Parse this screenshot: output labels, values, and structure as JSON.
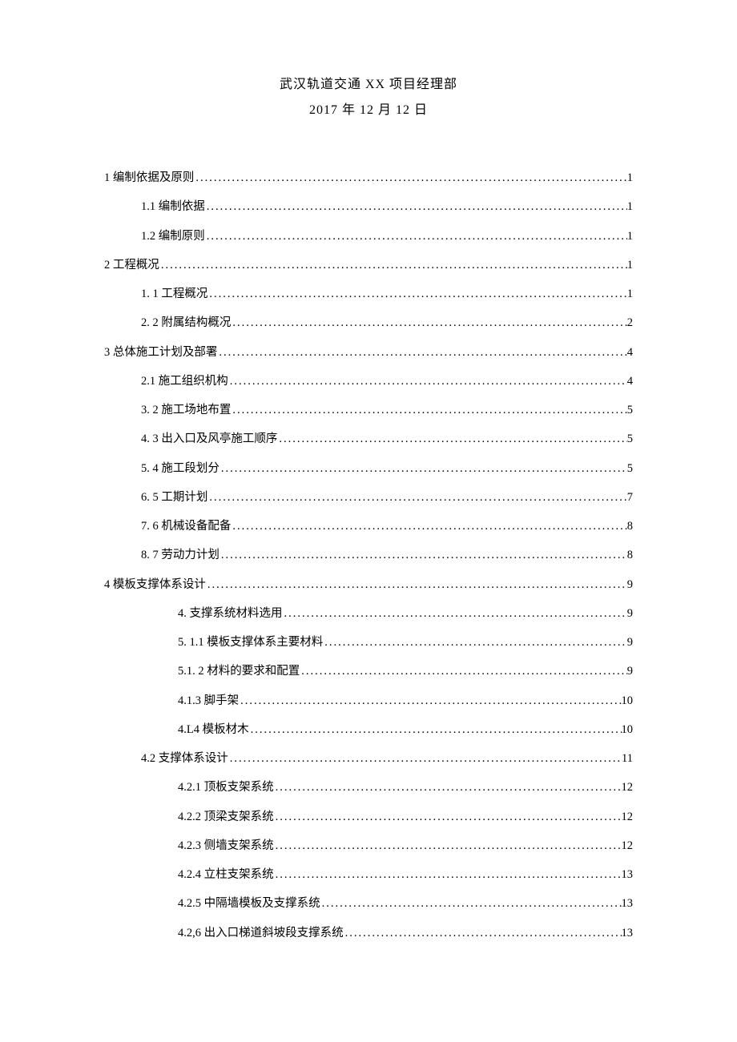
{
  "header": {
    "line1": "武汉轨道交通 XX 项目经理部",
    "line2": "2017 年 12 月 12 日"
  },
  "toc": [
    {
      "indent": 0,
      "label": "1 编制依据及原则",
      "page": "1"
    },
    {
      "indent": 1,
      "label": "1.1  编制依据",
      "page": "1"
    },
    {
      "indent": 1,
      "label": "1.2  编制原则",
      "page": "1"
    },
    {
      "indent": 0,
      "label": "2 工程概况",
      "page": "1"
    },
    {
      "indent": 1,
      "label": "1.  1 工程概况",
      "page": "1"
    },
    {
      "indent": 1,
      "label": "2.  2 附属结构概况",
      "page": "2"
    },
    {
      "indent": 0,
      "label": "3 总体施工计划及部署",
      "page": "4"
    },
    {
      "indent": 1,
      "label": "2.1  施工组织机构",
      "page": "4"
    },
    {
      "indent": 1,
      "label": "3.  2 施工场地布置",
      "page": "5"
    },
    {
      "indent": 1,
      "label": "4.  3 出入口及风亭施工顺序",
      "page": "5"
    },
    {
      "indent": 1,
      "label": "5.  4 施工段划分",
      "page": "5"
    },
    {
      "indent": 1,
      "label": "6.  5 工期计划",
      "page": "7"
    },
    {
      "indent": 1,
      "label": "7.  6 机械设备配备",
      "page": "8"
    },
    {
      "indent": 1,
      "label": "8.  7 劳动力计划",
      "page": "8"
    },
    {
      "indent": 0,
      "label": "4 模板支撑体系设计",
      "page": "9"
    },
    {
      "indent": 2,
      "label": "4.  支撑系统材料选用",
      "page": "9"
    },
    {
      "indent": 2,
      "label": "5.  1.1 模板支撑体系主要材料",
      "page": "9"
    },
    {
      "indent": 2,
      "label": "5.1.  2 材料的要求和配置",
      "page": "9"
    },
    {
      "indent": 2,
      "label": "4.1.3 脚手架",
      "page": "10"
    },
    {
      "indent": 2,
      "label": "4.L4 模板材木",
      "page": "10"
    },
    {
      "indent": 1,
      "label": "4.2 支撑体系设计",
      "page": "11"
    },
    {
      "indent": 2,
      "label": "4.2.1 顶板支架系统",
      "page": "12"
    },
    {
      "indent": 2,
      "label": "4.2.2 顶梁支架系统",
      "page": "12"
    },
    {
      "indent": 2,
      "label": "4.2.3 侧墙支架系统",
      "page": "12"
    },
    {
      "indent": 2,
      "label": "4.2.4 立柱支架系统",
      "page": "13"
    },
    {
      "indent": 2,
      "label": "4.2.5 中隔墙模板及支撑系统",
      "page": "13"
    },
    {
      "indent": 2,
      "label": "4.2,6 出入口梯道斜坡段支撑系统",
      "page": "13"
    }
  ]
}
